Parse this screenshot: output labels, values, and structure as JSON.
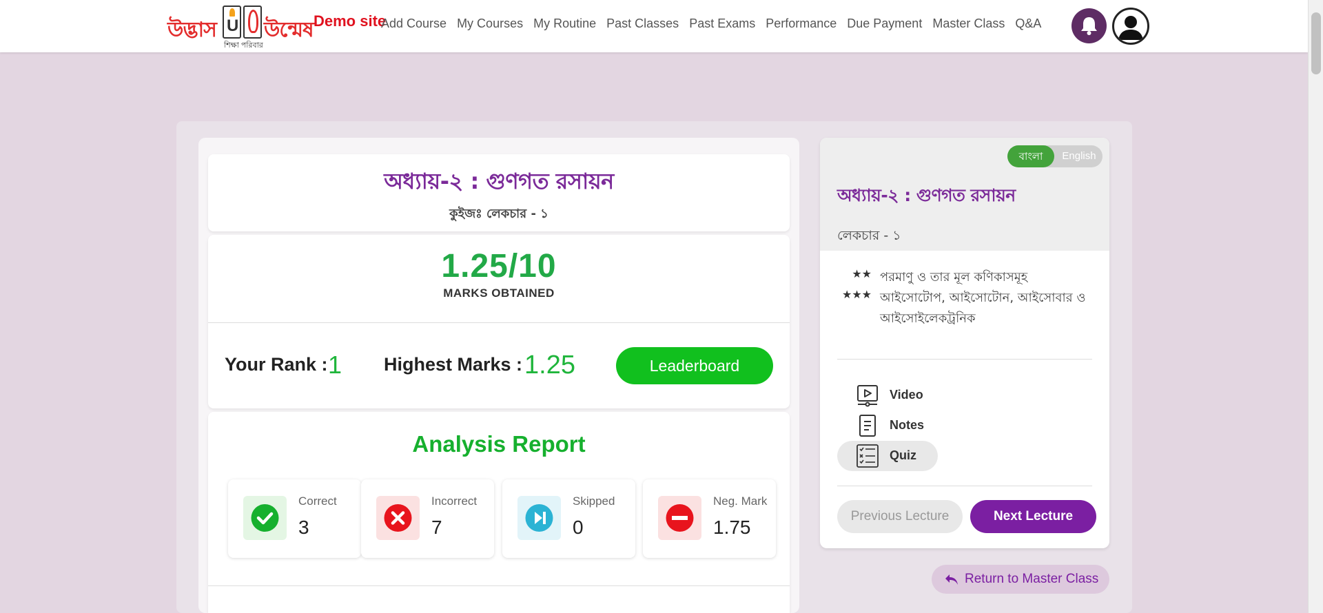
{
  "brand": {
    "logo_left": "উদ্ভাস",
    "logo_right": "উন্মেষ",
    "logo_sub": "শিক্ষা পরিবার",
    "demo_label": "Demo site"
  },
  "nav": {
    "items": [
      "Add Course",
      "My Courses",
      "My Routine",
      "Past Classes",
      "Past Exams",
      "Performance",
      "Due Payment",
      "Master Class",
      "Q&A"
    ],
    "bell_icon": "bell-icon",
    "avatar_icon": "user-avatar-icon"
  },
  "quiz": {
    "chapter_title": "অধ্যায়-২ : গুণগত রসায়ন",
    "quiz_subtitle": "কুইজঃ লেকচার - ১"
  },
  "result": {
    "score": "1.25/10",
    "marks_label": "MARKS OBTAINED",
    "rank_label": "Your Rank :",
    "rank_value": "1",
    "highest_label": "Highest Marks :",
    "highest_value": "1.25",
    "leaderboard_button": "Leaderboard"
  },
  "analysis": {
    "title": "Analysis Report",
    "stats": [
      {
        "label": "Correct",
        "value": "3",
        "icon": "check-circle-icon",
        "color": "#16b02e",
        "bg": "#e4f6e4"
      },
      {
        "label": "Incorrect",
        "value": "7",
        "icon": "x-circle-icon",
        "color": "#e8141d",
        "bg": "#fbe1e1"
      },
      {
        "label": "Skipped",
        "value": "0",
        "icon": "skip-forward-icon",
        "color": "#2bb3d4",
        "bg": "#e2f4f9"
      },
      {
        "label": "Neg. Mark",
        "value": "1.75",
        "icon": "minus-circle-icon",
        "color": "#e8141d",
        "bg": "#fbe1e1"
      }
    ]
  },
  "sidebar": {
    "lang_bangla": "বাংলা",
    "lang_english": "English",
    "chapter_title": "অধ্যায়-২ : গুণগত রসায়ন",
    "lecture_label": "লেকচার - ১",
    "topics": [
      {
        "stars": "★★",
        "text": "পরমাণু ও তার মূল কণিকাসমূহ"
      },
      {
        "stars": "★★★",
        "text": "আইসোটোপ, আইসোটোন, আইসোবার ও আইসোইলেকট্রনিক"
      }
    ],
    "resources": [
      {
        "label": "Video",
        "icon": "video-icon",
        "active": false
      },
      {
        "label": "Notes",
        "icon": "notes-icon",
        "active": false
      },
      {
        "label": "Quiz",
        "icon": "quiz-checklist-icon",
        "active": true
      }
    ],
    "prev_button": "Previous Lecture",
    "next_button": "Next Lecture"
  },
  "return_button": "Return to Master Class",
  "colors": {
    "brand_purple": "#7b2a99",
    "success_green": "#16b02e",
    "leaderboard_green": "#11c01e",
    "page_bg": "#e3d6e1"
  }
}
